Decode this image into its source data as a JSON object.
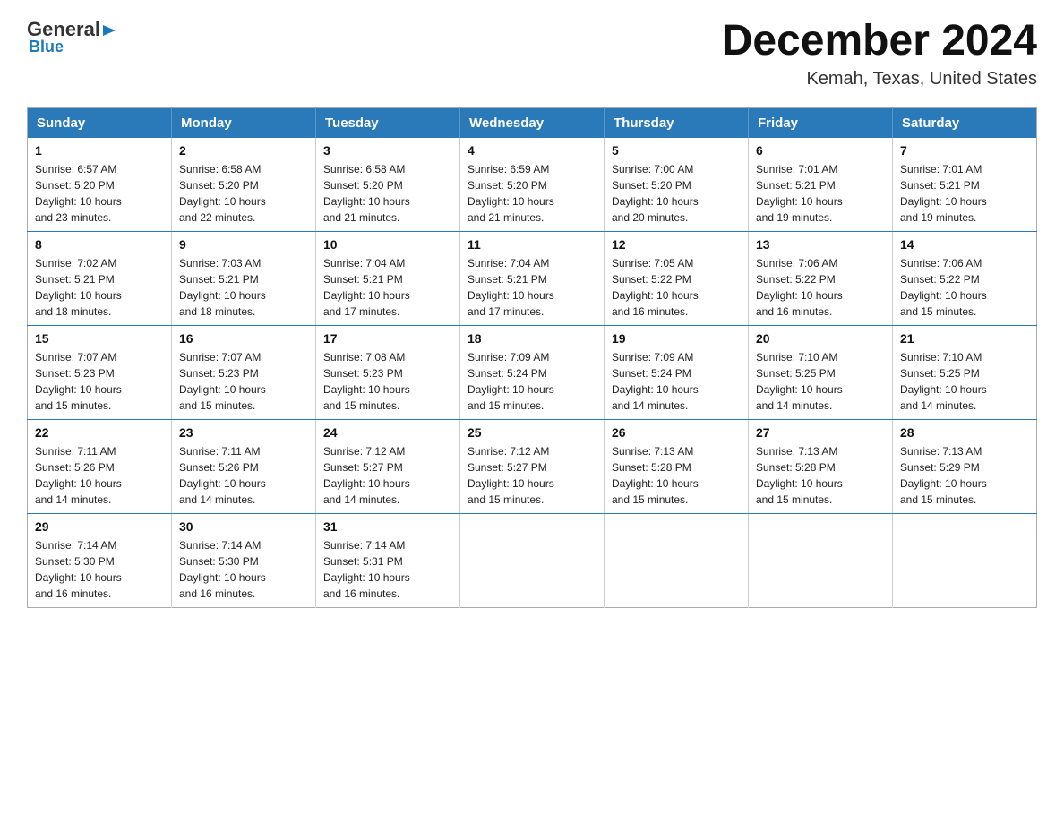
{
  "logo": {
    "general": "General",
    "blue": "Blue",
    "tagline": "Blue"
  },
  "header": {
    "month": "December 2024",
    "location": "Kemah, Texas, United States"
  },
  "weekdays": [
    "Sunday",
    "Monday",
    "Tuesday",
    "Wednesday",
    "Thursday",
    "Friday",
    "Saturday"
  ],
  "weeks": [
    [
      {
        "day": "1",
        "info": "Sunrise: 6:57 AM\nSunset: 5:20 PM\nDaylight: 10 hours\nand 23 minutes."
      },
      {
        "day": "2",
        "info": "Sunrise: 6:58 AM\nSunset: 5:20 PM\nDaylight: 10 hours\nand 22 minutes."
      },
      {
        "day": "3",
        "info": "Sunrise: 6:58 AM\nSunset: 5:20 PM\nDaylight: 10 hours\nand 21 minutes."
      },
      {
        "day": "4",
        "info": "Sunrise: 6:59 AM\nSunset: 5:20 PM\nDaylight: 10 hours\nand 21 minutes."
      },
      {
        "day": "5",
        "info": "Sunrise: 7:00 AM\nSunset: 5:20 PM\nDaylight: 10 hours\nand 20 minutes."
      },
      {
        "day": "6",
        "info": "Sunrise: 7:01 AM\nSunset: 5:21 PM\nDaylight: 10 hours\nand 19 minutes."
      },
      {
        "day": "7",
        "info": "Sunrise: 7:01 AM\nSunset: 5:21 PM\nDaylight: 10 hours\nand 19 minutes."
      }
    ],
    [
      {
        "day": "8",
        "info": "Sunrise: 7:02 AM\nSunset: 5:21 PM\nDaylight: 10 hours\nand 18 minutes."
      },
      {
        "day": "9",
        "info": "Sunrise: 7:03 AM\nSunset: 5:21 PM\nDaylight: 10 hours\nand 18 minutes."
      },
      {
        "day": "10",
        "info": "Sunrise: 7:04 AM\nSunset: 5:21 PM\nDaylight: 10 hours\nand 17 minutes."
      },
      {
        "day": "11",
        "info": "Sunrise: 7:04 AM\nSunset: 5:21 PM\nDaylight: 10 hours\nand 17 minutes."
      },
      {
        "day": "12",
        "info": "Sunrise: 7:05 AM\nSunset: 5:22 PM\nDaylight: 10 hours\nand 16 minutes."
      },
      {
        "day": "13",
        "info": "Sunrise: 7:06 AM\nSunset: 5:22 PM\nDaylight: 10 hours\nand 16 minutes."
      },
      {
        "day": "14",
        "info": "Sunrise: 7:06 AM\nSunset: 5:22 PM\nDaylight: 10 hours\nand 15 minutes."
      }
    ],
    [
      {
        "day": "15",
        "info": "Sunrise: 7:07 AM\nSunset: 5:23 PM\nDaylight: 10 hours\nand 15 minutes."
      },
      {
        "day": "16",
        "info": "Sunrise: 7:07 AM\nSunset: 5:23 PM\nDaylight: 10 hours\nand 15 minutes."
      },
      {
        "day": "17",
        "info": "Sunrise: 7:08 AM\nSunset: 5:23 PM\nDaylight: 10 hours\nand 15 minutes."
      },
      {
        "day": "18",
        "info": "Sunrise: 7:09 AM\nSunset: 5:24 PM\nDaylight: 10 hours\nand 15 minutes."
      },
      {
        "day": "19",
        "info": "Sunrise: 7:09 AM\nSunset: 5:24 PM\nDaylight: 10 hours\nand 14 minutes."
      },
      {
        "day": "20",
        "info": "Sunrise: 7:10 AM\nSunset: 5:25 PM\nDaylight: 10 hours\nand 14 minutes."
      },
      {
        "day": "21",
        "info": "Sunrise: 7:10 AM\nSunset: 5:25 PM\nDaylight: 10 hours\nand 14 minutes."
      }
    ],
    [
      {
        "day": "22",
        "info": "Sunrise: 7:11 AM\nSunset: 5:26 PM\nDaylight: 10 hours\nand 14 minutes."
      },
      {
        "day": "23",
        "info": "Sunrise: 7:11 AM\nSunset: 5:26 PM\nDaylight: 10 hours\nand 14 minutes."
      },
      {
        "day": "24",
        "info": "Sunrise: 7:12 AM\nSunset: 5:27 PM\nDaylight: 10 hours\nand 14 minutes."
      },
      {
        "day": "25",
        "info": "Sunrise: 7:12 AM\nSunset: 5:27 PM\nDaylight: 10 hours\nand 15 minutes."
      },
      {
        "day": "26",
        "info": "Sunrise: 7:13 AM\nSunset: 5:28 PM\nDaylight: 10 hours\nand 15 minutes."
      },
      {
        "day": "27",
        "info": "Sunrise: 7:13 AM\nSunset: 5:28 PM\nDaylight: 10 hours\nand 15 minutes."
      },
      {
        "day": "28",
        "info": "Sunrise: 7:13 AM\nSunset: 5:29 PM\nDaylight: 10 hours\nand 15 minutes."
      }
    ],
    [
      {
        "day": "29",
        "info": "Sunrise: 7:14 AM\nSunset: 5:30 PM\nDaylight: 10 hours\nand 16 minutes."
      },
      {
        "day": "30",
        "info": "Sunrise: 7:14 AM\nSunset: 5:30 PM\nDaylight: 10 hours\nand 16 minutes."
      },
      {
        "day": "31",
        "info": "Sunrise: 7:14 AM\nSunset: 5:31 PM\nDaylight: 10 hours\nand 16 minutes."
      },
      null,
      null,
      null,
      null
    ]
  ]
}
